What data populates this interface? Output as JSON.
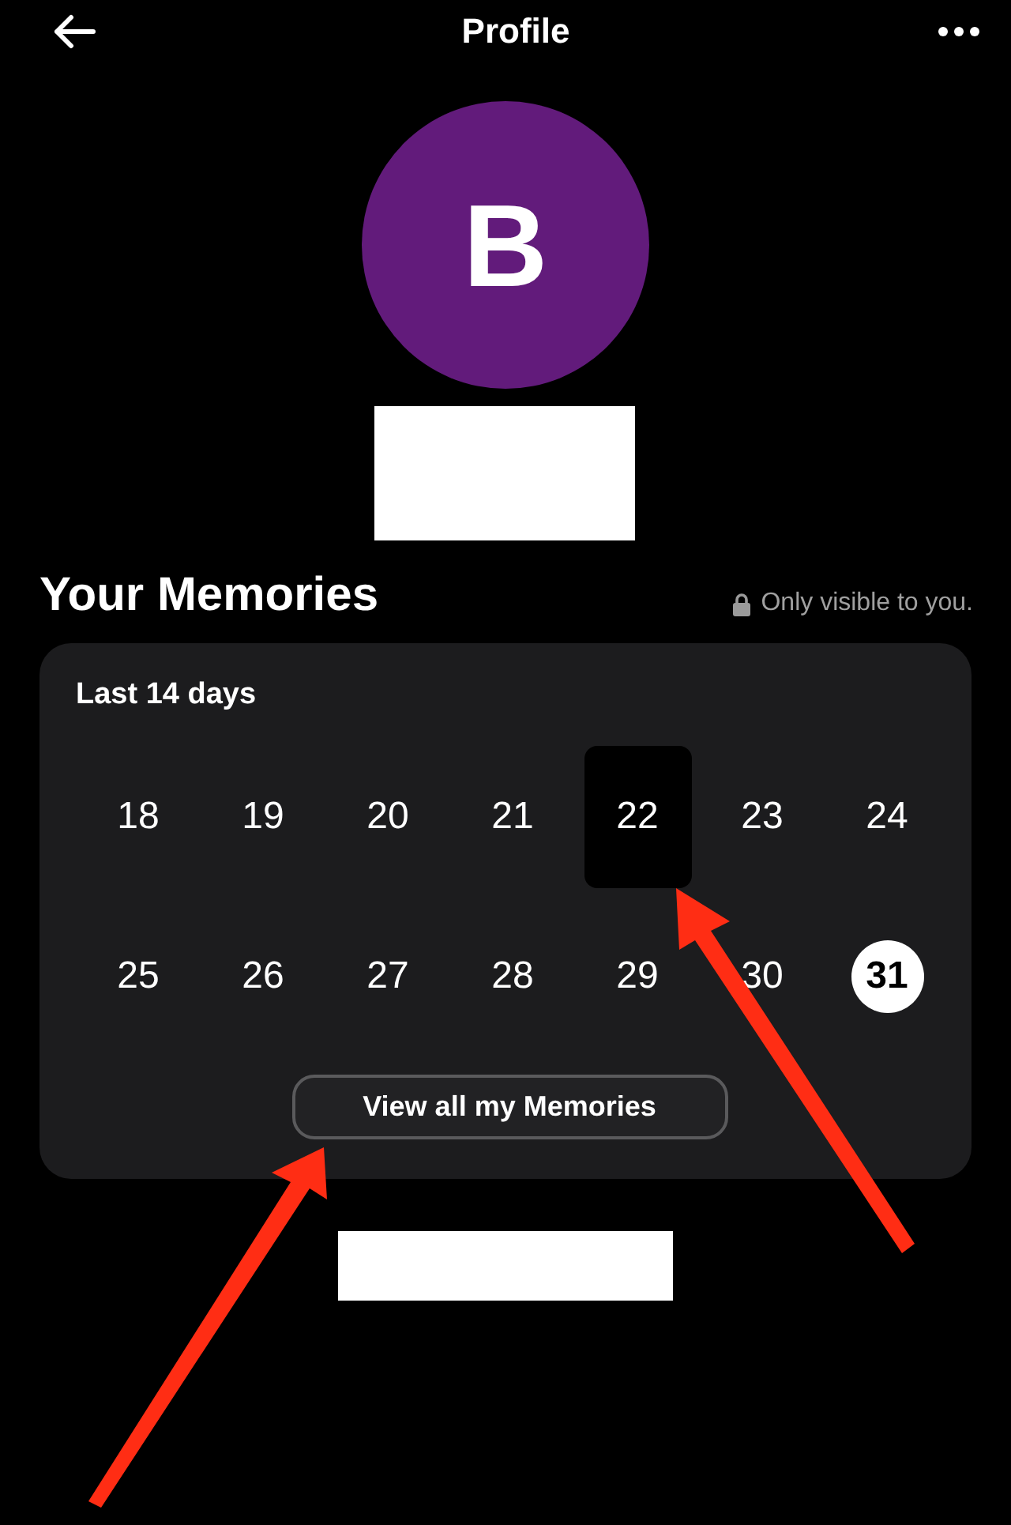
{
  "header": {
    "title": "Profile"
  },
  "profile": {
    "initial": "B"
  },
  "memories": {
    "title": "Your Memories",
    "privacy_note": "Only visible to you.",
    "range_label": "Last 14 days",
    "days": [
      {
        "label": "18",
        "kind": "plain"
      },
      {
        "label": "19",
        "kind": "plain"
      },
      {
        "label": "20",
        "kind": "plain"
      },
      {
        "label": "21",
        "kind": "plain"
      },
      {
        "label": "22",
        "kind": "memory"
      },
      {
        "label": "23",
        "kind": "plain"
      },
      {
        "label": "24",
        "kind": "plain"
      },
      {
        "label": "25",
        "kind": "plain"
      },
      {
        "label": "26",
        "kind": "plain"
      },
      {
        "label": "27",
        "kind": "plain"
      },
      {
        "label": "28",
        "kind": "plain"
      },
      {
        "label": "29",
        "kind": "plain"
      },
      {
        "label": "30",
        "kind": "plain"
      },
      {
        "label": "31",
        "kind": "today"
      }
    ],
    "button": "View all my Memories"
  }
}
